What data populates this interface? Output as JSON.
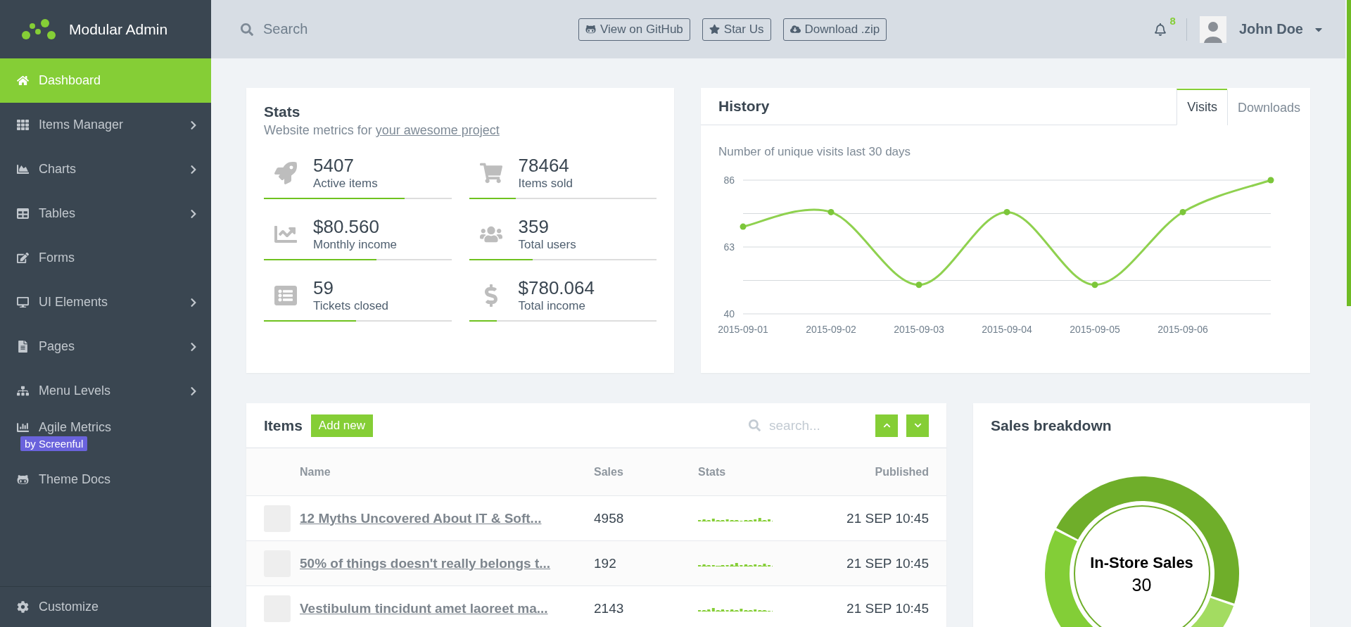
{
  "brand": {
    "title": "Modular Admin"
  },
  "sidebar": {
    "items": [
      {
        "label": "Dashboard",
        "selected": true,
        "submenu": false
      },
      {
        "label": "Items Manager",
        "selected": false,
        "submenu": true
      },
      {
        "label": "Charts",
        "selected": false,
        "submenu": true
      },
      {
        "label": "Tables",
        "selected": false,
        "submenu": true
      },
      {
        "label": "Forms",
        "selected": false,
        "submenu": false
      },
      {
        "label": "UI Elements",
        "selected": false,
        "submenu": true
      },
      {
        "label": "Pages",
        "selected": false,
        "submenu": true
      },
      {
        "label": "Menu Levels",
        "selected": false,
        "submenu": true
      },
      {
        "label": "Agile Metrics",
        "selected": false,
        "submenu": false,
        "badge": "by Screenful"
      },
      {
        "label": "Theme Docs",
        "selected": false,
        "submenu": false
      }
    ],
    "footer": "Customize"
  },
  "header": {
    "search": {
      "placeholder": "Search"
    },
    "buttons": [
      "View on GitHub",
      "Star Us",
      "Download .zip"
    ],
    "notifications": "8",
    "user": "John Doe"
  },
  "stats": {
    "title": "Stats",
    "subtitle": "Website metrics for",
    "link": "your awesome project",
    "items": [
      {
        "value": "5407",
        "label": "Active items",
        "level": 0.75
      },
      {
        "value": "78464",
        "label": "Items sold",
        "level": 0.25
      },
      {
        "value": "$80.560",
        "label": "Monthly income",
        "level": 0.6
      },
      {
        "value": "359",
        "label": "Total users",
        "level": 0.34
      },
      {
        "value": "59",
        "label": "Tickets closed",
        "level": 0.49
      },
      {
        "value": "$780.064",
        "label": "Total income",
        "level": 0.15
      }
    ]
  },
  "history": {
    "title": "History",
    "tabs": [
      {
        "label": "Visits",
        "selected": true
      },
      {
        "label": "Downloads",
        "selected": false
      }
    ],
    "caption": "Number of unique visits last 30 days",
    "chart_data": {
      "type": "line",
      "categories": [
        "2015-09-01",
        "2015-09-02",
        "2015-09-03",
        "2015-09-04",
        "2015-09-05",
        "2015-09-06",
        null
      ],
      "yticks": [
        40,
        63,
        86
      ],
      "ylim": [
        40,
        86
      ],
      "series": [
        {
          "color": "#8fd14f",
          "marker": "circle",
          "values": [
            70,
            75,
            50,
            75,
            50,
            75,
            86
          ]
        }
      ]
    }
  },
  "items": {
    "title": "Items",
    "add_button": "Add new",
    "search": {
      "placeholder": "search..."
    },
    "columns": [
      "Name",
      "Sales",
      "Stats",
      "Published"
    ],
    "rows": [
      {
        "name": "12 Myths Uncovered About IT & Soft...",
        "sales": "4958",
        "published": "21 SEP 10:45"
      },
      {
        "name": "50% of things doesn't really belongs t...",
        "sales": "192",
        "published": "21 SEP 10:45"
      },
      {
        "name": "Vestibulum tincidunt amet laoreet ma...",
        "sales": "2143",
        "published": "21 SEP 10:45"
      }
    ]
  },
  "sales": {
    "title": "Sales breakdown",
    "center_label": "In-Store Sales",
    "center_value": "30"
  }
}
